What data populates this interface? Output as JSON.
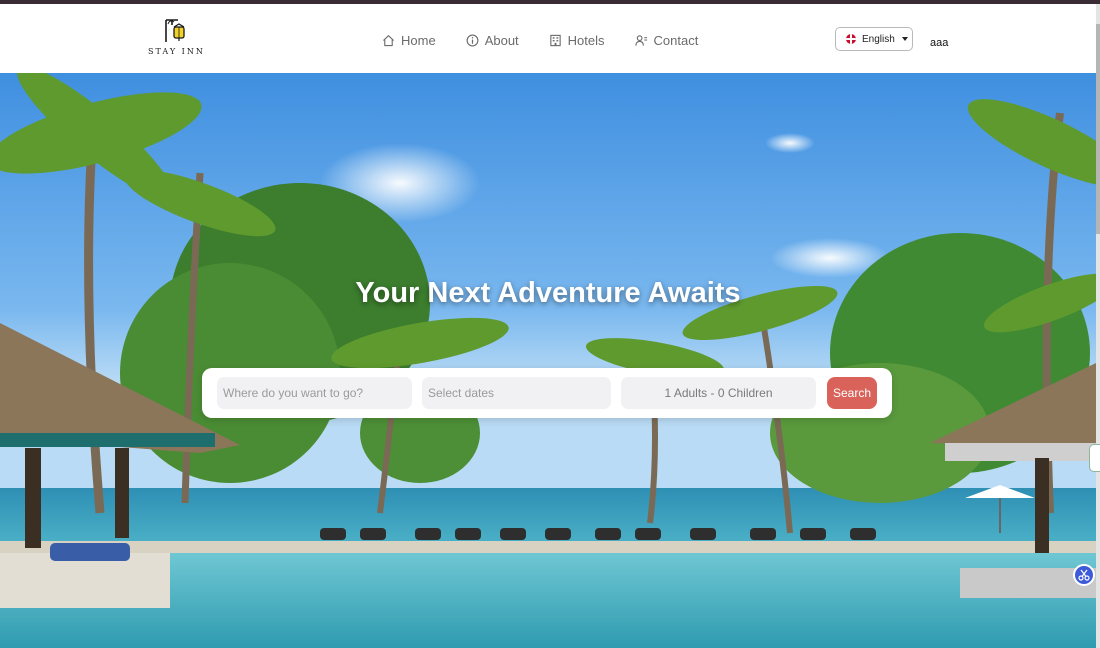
{
  "brand": {
    "name": "STAY INN"
  },
  "nav": {
    "items": [
      {
        "label": "Home",
        "icon": "home-icon"
      },
      {
        "label": "About",
        "icon": "info-icon"
      },
      {
        "label": "Hotels",
        "icon": "building-icon"
      },
      {
        "label": "Contact",
        "icon": "contact-icon"
      }
    ]
  },
  "language": {
    "label": "English",
    "flag": "uk-flag-icon"
  },
  "user": {
    "name": "aaa"
  },
  "hero": {
    "headline": "Your Next Adventure Awaits",
    "background": "tropical-resort-pool-beach-palms"
  },
  "search": {
    "destination_placeholder": "Where do you want to go?",
    "dates_placeholder": "Select dates",
    "guests_label": "1 Adults - 0 Children",
    "button_label": "Search"
  },
  "colors": {
    "accent": "#d9635a",
    "top_strip": "#3a2c34",
    "nav_text": "#6b6b6b"
  }
}
